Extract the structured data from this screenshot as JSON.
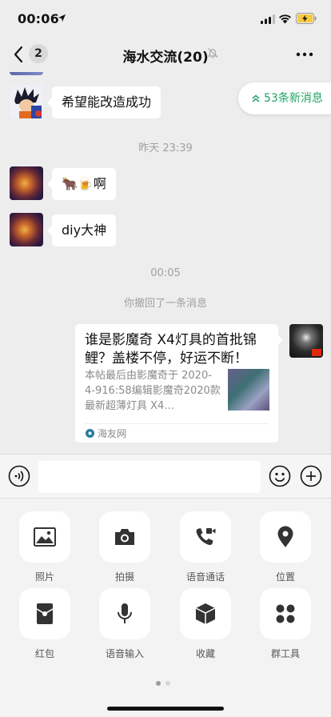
{
  "status": {
    "time": "00:06"
  },
  "nav": {
    "back_count": "2",
    "title": "海水交流(20)"
  },
  "new_messages": "53条新消息",
  "messages": [
    {
      "text": "希望能改造成功"
    },
    {
      "time": "昨天 23:39"
    },
    {
      "text": "🐂🍺啊"
    },
    {
      "text": "diy大神"
    },
    {
      "time": "00:05"
    },
    {
      "system": "你撤回了一条消息"
    }
  ],
  "link_card": {
    "title": "谁是影魔奇 X4灯具的首批锦鲤？盖楼不停，好运不断！",
    "description": "本帖最后由影魔奇于 2020-4-916:58编辑影魔奇2020款最新超薄灯具 X4...",
    "source": "海友网"
  },
  "input": {
    "value": ""
  },
  "panel": {
    "items": [
      {
        "label": "照片",
        "icon": "photo-icon"
      },
      {
        "label": "拍摄",
        "icon": "camera-icon"
      },
      {
        "label": "语音通话",
        "icon": "voice-call-icon"
      },
      {
        "label": "位置",
        "icon": "location-icon"
      },
      {
        "label": "红包",
        "icon": "red-packet-icon"
      },
      {
        "label": "语音输入",
        "icon": "microphone-icon"
      },
      {
        "label": "收藏",
        "icon": "favorites-icon"
      },
      {
        "label": "群工具",
        "icon": "group-tools-icon"
      }
    ]
  },
  "colors": {
    "accent": "#21a366",
    "background": "#ededed",
    "panel": "#f3f3f3"
  }
}
